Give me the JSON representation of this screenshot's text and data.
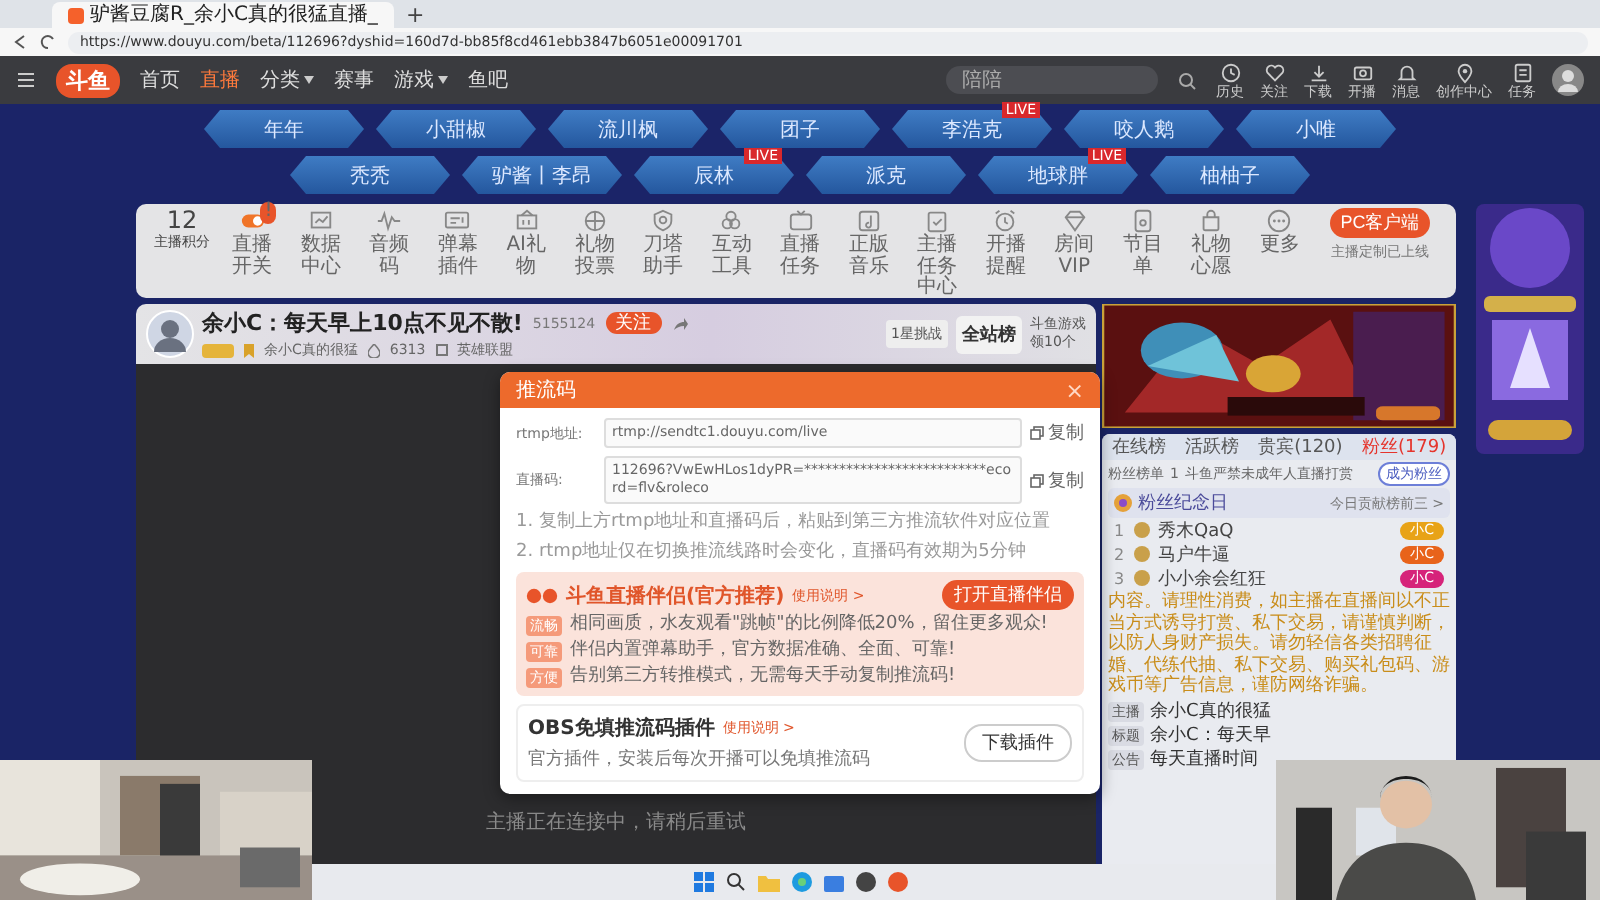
{
  "browser": {
    "tab_title": "驴酱豆腐R_余小C真的很猛直播_",
    "new_tab": "+",
    "url": "https://www.douyu.com/beta/112696?dyshid=160d7d-bb85f8cd461ebb3847b6051e00091701"
  },
  "nav": {
    "logo": "斗鱼",
    "links": [
      {
        "label": "首页",
        "selected": false,
        "dropdown": false
      },
      {
        "label": "直播",
        "selected": true,
        "dropdown": false
      },
      {
        "label": "分类",
        "selected": false,
        "dropdown": true
      },
      {
        "label": "赛事",
        "selected": false,
        "dropdown": false
      },
      {
        "label": "游戏",
        "selected": false,
        "dropdown": true
      },
      {
        "label": "鱼吧",
        "selected": false,
        "dropdown": false
      }
    ],
    "search": {
      "placeholder": "陪陪"
    },
    "actions": [
      {
        "label": "历史"
      },
      {
        "label": "关注"
      },
      {
        "label": "下载"
      },
      {
        "label": "开播"
      },
      {
        "label": "消息"
      },
      {
        "label": "创作中心"
      },
      {
        "label": "任务"
      }
    ]
  },
  "streamers": [
    [
      {
        "name": "年年"
      },
      {
        "name": "小甜椒"
      },
      {
        "name": "流川枫"
      },
      {
        "name": "团子"
      },
      {
        "name": "李浩克",
        "badge": "LIVE"
      },
      {
        "name": "咬人鹅"
      },
      {
        "name": "小唯"
      }
    ],
    [
      {
        "name": "秃秃"
      },
      {
        "name": "驴酱丨李昂"
      },
      {
        "name": "辰林",
        "badge": "LIVE"
      },
      {
        "name": "派克"
      },
      {
        "name": "地球胖",
        "badge": "LIVE"
      },
      {
        "name": "柚柚子"
      }
    ]
  ],
  "toolbar": {
    "score": "12",
    "score_label": "主播积分",
    "items": [
      {
        "label": "直播开关",
        "badge": "!"
      },
      {
        "label": "数据中心"
      },
      {
        "label": "音频码"
      },
      {
        "label": "弹幕插件"
      },
      {
        "label": "AI礼物"
      },
      {
        "label": "礼物投票"
      },
      {
        "label": "刀塔助手"
      },
      {
        "label": "互动工具"
      },
      {
        "label": "直播任务"
      },
      {
        "label": "正版音乐"
      },
      {
        "label": "主播任务中心"
      },
      {
        "label": "开播提醒"
      },
      {
        "label": "房间VIP"
      },
      {
        "label": "节目单"
      },
      {
        "label": "礼物心愿"
      },
      {
        "label": "更多"
      }
    ],
    "client_button": "PC客户端",
    "client_note": "主播定制已上线"
  },
  "room": {
    "title": "余小C：每天早上10点不见不散!",
    "room_id": "5155124",
    "follow": "关注",
    "owner": "余小C真的很猛",
    "hot": "6313",
    "category": "英雄联盟",
    "challenge": "1星挑战",
    "rank": "全站榜",
    "game_promo": "斗鱼游戏",
    "game_reward": "领10个"
  },
  "video": {
    "status": "主播正在连接中，请稍后重试"
  },
  "chat": {
    "tabs": [
      {
        "label": "在线榜",
        "selected": false
      },
      {
        "label": "活跃榜",
        "selected": false
      },
      {
        "label": "贵宾(120)",
        "selected": false
      },
      {
        "label": "粉丝(179)",
        "selected": true
      }
    ],
    "fan_label": "粉丝榜单",
    "fan_rank": "1",
    "fan_note": "斗鱼严禁未成年人直播打赏",
    "fan_button": "成为粉丝",
    "contrib_title": "粉丝纪念日",
    "contrib_link": "今日贡献榜前三 >",
    "contributors": [
      {
        "rank": "1",
        "name": "秀木QaQ",
        "badge": "小C",
        "color": "#e8a317"
      },
      {
        "rank": "2",
        "name": "马户牛逼",
        "badge": "小C",
        "color": "#e8631a"
      },
      {
        "rank": "3",
        "name": "小小余会红狂",
        "badge": "小C",
        "color": "#d6237a"
      }
    ],
    "notice": "内容。请理性消费，如主播在直播间以不正当方式诱导打赏、私下交易，请谨慎判断，以防人身财产损失。请勿轻信各类招聘征婚、代练代抽、私下交易、购买礼包码、游戏币等广告信息，谨防网络诈骗。",
    "messages": [
      {
        "role": "主播",
        "text": "余小C真的很猛"
      },
      {
        "role": "标题",
        "text": "余小C：每天早"
      },
      {
        "role": "公告",
        "text": "每天直播时间"
      }
    ]
  },
  "dialog": {
    "title": "推流码",
    "close": "×",
    "fields": [
      {
        "label": "rtmp地址:",
        "value": "rtmp://sendtc1.douyu.com/live",
        "copy": "复制"
      },
      {
        "label": "直播码:",
        "value": "112696?VwEwHLos1dyPR=**************************ecord=flv&roleco",
        "copy": "复制"
      }
    ],
    "notes": [
      "1. 复制上方rtmp地址和直播码后，粘贴到第三方推流软件对应位置",
      "2. rtmp地址仅在切换推流线路时会变化，直播码有效期为5分钟"
    ],
    "companion": {
      "title": "斗鱼直播伴侣(官方推荐)",
      "help": "使用说明 >",
      "button": "打开直播伴侣",
      "points": [
        {
          "tag": "流畅",
          "text": "相同画质，水友观看\"跳帧\"的比例降低20%，留住更多观众!"
        },
        {
          "tag": "可靠",
          "text": "伴侣内置弹幕助手，官方数据准确、全面、可靠!"
        },
        {
          "tag": "方便",
          "text": "告别第三方转推模式，无需每天手动复制推流码!"
        }
      ]
    },
    "plugin": {
      "title": "OBS免填推流码插件",
      "help": "使用说明 >",
      "desc": "官方插件，安装后每次开播可以免填推流码",
      "button": "下载插件"
    }
  }
}
